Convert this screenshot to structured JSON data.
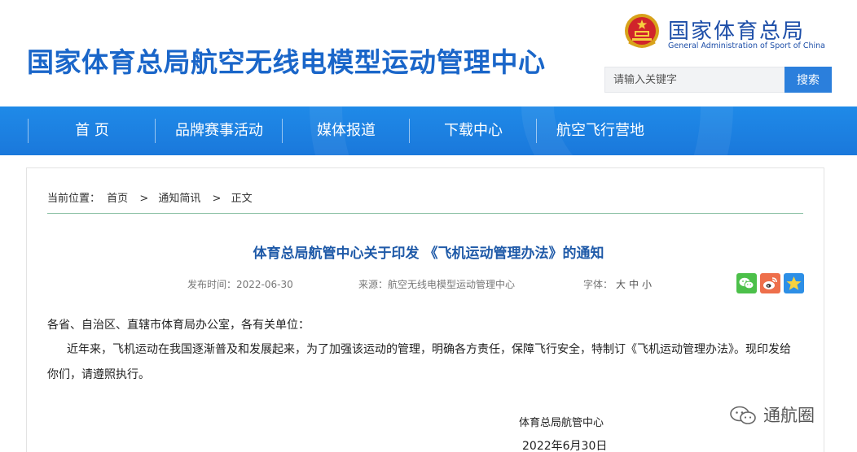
{
  "header": {
    "site_title": "国家体育总局航空无线电模型运动管理中心",
    "brand_cn": "国家体育总局",
    "brand_en": "General Administration of Sport of China",
    "search_placeholder": "请输入关键字",
    "search_button": "搜索"
  },
  "nav": {
    "items": [
      "首 页",
      "品牌赛事活动",
      "媒体报道",
      "下载中心",
      "航空飞行营地"
    ]
  },
  "breadcrumb": {
    "label": "当前位置：",
    "items": [
      "首页",
      "通知简讯",
      "正文"
    ],
    "separator": ">"
  },
  "article": {
    "title": "体育总局航管中心关于印发 《飞机运动管理办法》的通知",
    "date_label": "发布时间：2022-06-30",
    "source_label": "来源：航空无线电模型运动管理中心",
    "font_label": "字体：",
    "font_sizes": [
      "大",
      "中",
      "小"
    ],
    "greeting": "各省、自治区、直辖市体育局办公室，各有关单位：",
    "line1": "近年来，飞机运动在我国逐渐普及和发展起来，为了加强该运动的管理，明确各方责任，保障飞行安全，特制订《飞机运动管理办法》。现印发给",
    "line2": "你们，请遵照执行。",
    "sign_org": "体育总局航管中心",
    "sign_date": "2022年6月30日"
  },
  "share": {
    "icons": [
      "wechat-icon",
      "weibo-icon",
      "favorite-star-icon"
    ],
    "colors": {
      "wechat": "#4cc04a",
      "weibo": "#ee6f4b",
      "favorite": "#2d8fe6"
    }
  },
  "watermark": {
    "text": "通航圈"
  },
  "colors": {
    "title_blue": "#1a66c9",
    "nav_blue": "#1a78db",
    "article_title": "#1f5aa8",
    "search_button": "#2b7fdc"
  }
}
